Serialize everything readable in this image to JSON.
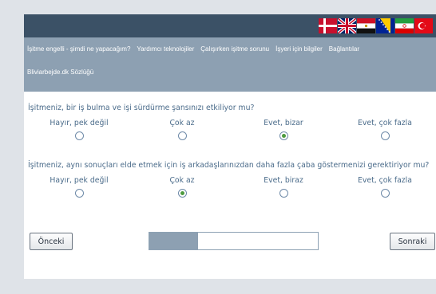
{
  "languages": [
    {
      "name": "Danish",
      "icon": "flag-denmark-icon"
    },
    {
      "name": "English",
      "icon": "flag-uk-icon"
    },
    {
      "name": "Arabic",
      "icon": "flag-egypt-icon"
    },
    {
      "name": "Bosnian",
      "icon": "flag-bosnia-icon"
    },
    {
      "name": "Persian",
      "icon": "flag-iran-icon"
    },
    {
      "name": "Turkish",
      "icon": "flag-turkey-icon"
    }
  ],
  "nav": {
    "links": [
      "İşitme engelli - şimdi ne yapacağım?",
      "Yardımcı teknolojiler",
      "Çalışırken işitme sorunu",
      "İşyeri için bilgiler",
      "Bağlantılar",
      "Bliviarbejde.dk Sözlüğü"
    ]
  },
  "questions": [
    {
      "text": "İşitmeniz, bir iş bulma ve işi sürdürme şansınızı etkiliyor mu?",
      "options": [
        "Hayır, pek değil",
        "Çok az",
        "Evet, bizar",
        "Evet, çok fazla"
      ],
      "selected_index": 2
    },
    {
      "text": "İşitmeniz, aynı sonuçları elde etmek için iş arkadaşlarınızdan daha fazla çaba göstermenizi gerektiriyor mu?",
      "options": [
        "Hayır, pek değil",
        "Çok az",
        "Evet, biraz",
        "Evet, çok fazla"
      ],
      "selected_index": 1
    }
  ],
  "footer": {
    "prev_label": "Önceki",
    "next_label": "Sonraki",
    "progress_fraction": 0.29
  },
  "colors": {
    "topbar": "#3b5166",
    "nav": "#8da0b2",
    "question_text": "#4a6b8a",
    "radio_selected": "#4d9a3e"
  }
}
